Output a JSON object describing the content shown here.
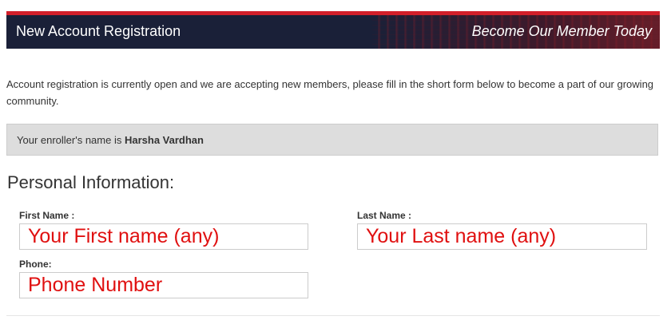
{
  "header": {
    "title": "New Account Registration",
    "tagline": "Become Our Member Today"
  },
  "intro": {
    "text": "Account registration is currently open and we are accepting new members, please fill in the short form below to become a part of our growing community."
  },
  "enroller": {
    "prefix": "Your enroller's name is ",
    "name": "Harsha Vardhan"
  },
  "personal_info": {
    "heading": "Personal Information:",
    "first_name": {
      "label": "First Name :",
      "placeholder": "Your First name (any)"
    },
    "last_name": {
      "label": "Last Name :",
      "placeholder": "Your Last name (any)"
    },
    "phone": {
      "label": "Phone:",
      "placeholder": "Phone Number"
    }
  },
  "colors": {
    "banner_bg": "#1a2038",
    "banner_accent": "#d21f2a",
    "placeholder_text": "#e01010",
    "enroller_bg": "#dddddd"
  }
}
